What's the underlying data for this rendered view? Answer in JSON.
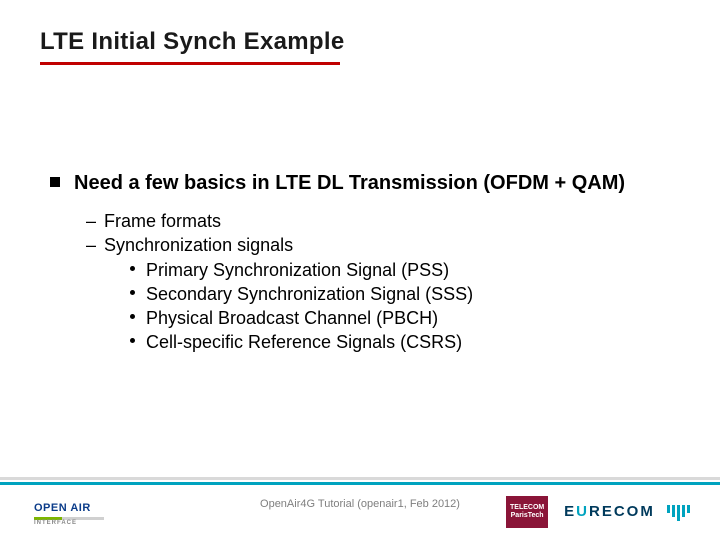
{
  "title": "LTE Initial Synch Example",
  "content": {
    "main_bullet": "Need a few basics in LTE DL Transmission (OFDM + QAM)",
    "sub": {
      "a": "Frame formats",
      "b": "Synchronization signals",
      "b_items": {
        "i": "Primary Synchronization Signal (PSS)",
        "ii": "Secondary Synchronization Signal (SSS)",
        "iii": "Physical Broadcast Channel (PBCH)",
        "iv": "Cell-specific Reference Signals (CSRS)"
      }
    }
  },
  "footer": {
    "text": "OpenAir4G Tutorial (openair1, Feb 2012)"
  },
  "logos": {
    "left_open": "OPEN",
    "left_air": "AIR",
    "left_sub": "INTERFACE",
    "telecom_l1": "TELECOM",
    "telecom_l2": "ParisTech",
    "eurecom_pre": "E",
    "eurecom_u": "U",
    "eurecom_post": "RECOM"
  }
}
